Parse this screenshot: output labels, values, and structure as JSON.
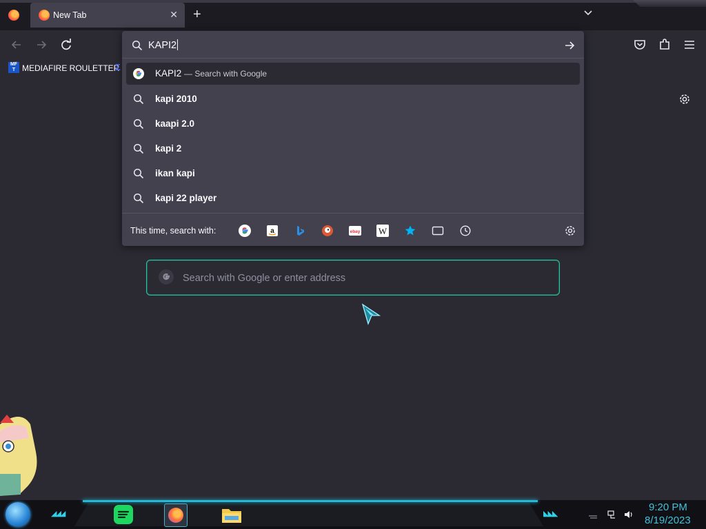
{
  "browser": {
    "tab": {
      "title": "New Tab",
      "close_glyph": "✕"
    },
    "new_tab_glyph": "+",
    "bookmarks": [
      {
        "icon_text": "MF T",
        "label": "MEDIAFIRE ROULETTER"
      }
    ]
  },
  "urlbar": {
    "value": "KAPI2",
    "suggestions": [
      {
        "icon": "google-icon",
        "text": "KAPI2",
        "suffix": "— Search with Google",
        "selected": true
      },
      {
        "icon": "search-icon",
        "text": "kapi 2010"
      },
      {
        "icon": "search-icon",
        "text": "kaapi 2.0"
      },
      {
        "icon": "search-icon",
        "text": "kapi 2"
      },
      {
        "icon": "search-icon",
        "text": "ikan kapi"
      },
      {
        "icon": "search-icon",
        "text": "kapi 22 player"
      }
    ],
    "engines_label": "This time, search with:",
    "engines": [
      "google-icon",
      "amazon-icon",
      "bing-icon",
      "duckduckgo-icon",
      "ebay-icon",
      "wikipedia-icon",
      "bookmarks-star-icon",
      "tabs-icon",
      "history-icon"
    ]
  },
  "newtab": {
    "search_placeholder": "Search with Google or enter address"
  },
  "taskbar": {
    "time": "9:20 PM",
    "date": "8/19/2023"
  },
  "colors": {
    "accent": "#2ac3a2",
    "taskbar_glow": "#27b8d6",
    "clock": "#42c0d8"
  }
}
